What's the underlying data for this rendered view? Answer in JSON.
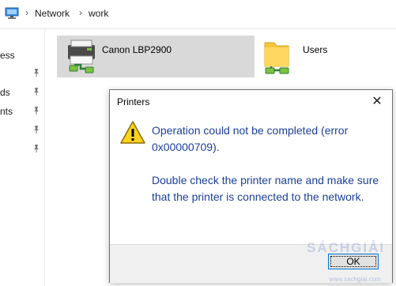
{
  "address_bar": {
    "crumbs": [
      "Network",
      "work"
    ],
    "icon": "computer-icon"
  },
  "nav_pane": {
    "items": [
      "ess",
      "ds",
      "nts"
    ],
    "pin_icon": "pin-icon"
  },
  "content": {
    "items": [
      {
        "label": "Canon LBP2900",
        "icon": "network-printer-icon"
      },
      {
        "label": "Users",
        "icon": "shared-folder-icon"
      }
    ]
  },
  "dialog": {
    "title": "Printers",
    "close_glyph": "✕",
    "icon": "warning-icon",
    "message_line1": "Operation could not be completed (error 0x00000709).",
    "message_line2": "Double check the printer name and make sure that the printer is connected to the network.",
    "ok_label": "OK"
  },
  "watermark": {
    "text": "SÁCHGIẢI",
    "url": "www.sachgiai.com"
  },
  "colors": {
    "message": "#1c3f9a",
    "selection": "#d9d9d9",
    "button_border": "#0078d7"
  }
}
